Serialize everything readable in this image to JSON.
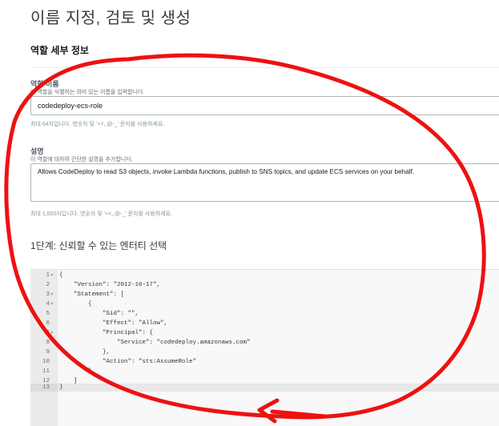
{
  "page": {
    "title": "이름 지정, 검토 및 생성"
  },
  "role_details": {
    "section_title": "역할 세부 정보",
    "name_label": "역할 이름",
    "name_description": "이 역할을 식별하는 의미 있는 이름을 입력합니다.",
    "name_value": "codedeploy-ecs-role",
    "name_hint": "최대 64자입니다. 영숫자 및 '+=,.@-_' 문자를 사용하세요.",
    "desc_label": "설명",
    "desc_description": "이 역할에 대하여 간단한 설명을 추가합니다.",
    "desc_value": "Allows CodeDeploy to read S3 objects, invoke Lambda functions, publish to SNS topics, and update ECS services on your behalf.",
    "desc_hint": "최대 1,000자입니다. 영숫자 및 '+=,.@-_' 문자를 사용하세요."
  },
  "step1": {
    "title": "1단계: 신뢰할 수 있는 엔터티 선택",
    "lines": [
      {
        "num": "1",
        "fold": "▾",
        "text": "{"
      },
      {
        "num": "2",
        "fold": "",
        "text": "    \"Version\": \"2012-10-17\","
      },
      {
        "num": "3",
        "fold": "▾",
        "text": "    \"Statement\": ["
      },
      {
        "num": "4",
        "fold": "▾",
        "text": "        {"
      },
      {
        "num": "5",
        "fold": "",
        "text": "            \"Sid\": \"\","
      },
      {
        "num": "6",
        "fold": "",
        "text": "            \"Effect\": \"Allow\","
      },
      {
        "num": "7",
        "fold": "▾",
        "text": "            \"Principal\": {"
      },
      {
        "num": "8",
        "fold": "",
        "text": "                \"Service\": \"codedeploy.amazonaws.com\""
      },
      {
        "num": "9",
        "fold": "",
        "text": "            },"
      },
      {
        "num": "10",
        "fold": "",
        "text": "            \"Action\": \"sts:AssumeRole\""
      },
      {
        "num": "11",
        "fold": "",
        "text": "        }"
      },
      {
        "num": "12",
        "fold": "",
        "text": "    ]"
      },
      {
        "num": "13",
        "fold": "",
        "text": "}"
      }
    ]
  },
  "colors": {
    "annotation": "#ee1111",
    "key": "#2d3a8c",
    "string": "#1a6e1a"
  }
}
